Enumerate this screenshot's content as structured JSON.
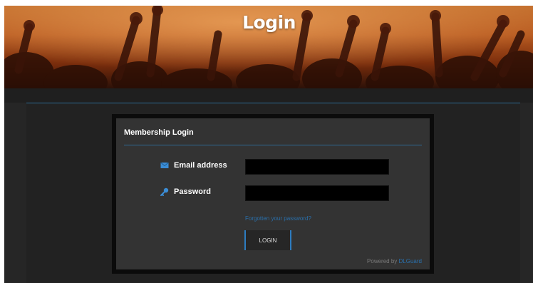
{
  "header": {
    "title": "Login"
  },
  "form": {
    "title": "Membership Login",
    "email_label": "Email address",
    "email_value": "",
    "password_label": "Password",
    "password_value": "",
    "forgot_link": "Forgotten your password?",
    "login_button": "LOGIN",
    "powered_by_prefix": "Powered by",
    "powered_by_link": "DLGuard"
  },
  "icons": {
    "email": "envelope-icon",
    "password": "key-icon"
  },
  "colors": {
    "accent": "#2d7cc0",
    "link": "#2a6faa",
    "background": "#262626",
    "card": "#333333"
  }
}
